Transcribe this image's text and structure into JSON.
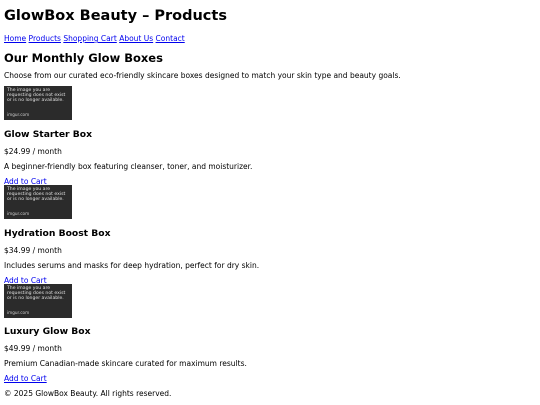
{
  "header": {
    "title": "GlowBox Beauty – Products"
  },
  "nav": {
    "items": [
      "Home",
      "Products",
      "Shopping Cart",
      "About Us",
      "Contact"
    ]
  },
  "main": {
    "heading": "Our Monthly Glow Boxes",
    "intro": "Choose from our curated eco-friendly skincare boxes designed to match your skin type and beauty goals.",
    "placeholder": {
      "line1": "The image you are",
      "line2": "requesting does not exist",
      "line3": "or is no longer available.",
      "brand": "imgur.com"
    },
    "products": [
      {
        "name": "Glow Starter Box",
        "price": "$24.99 / month",
        "description": "A beginner-friendly box featuring cleanser, toner, and moisturizer.",
        "cta": "Add to Cart"
      },
      {
        "name": "Hydration Boost Box",
        "price": "$34.99 / month",
        "description": "Includes serums and masks for deep hydration, perfect for dry skin.",
        "cta": "Add to Cart"
      },
      {
        "name": "Luxury Glow Box",
        "price": "$49.99 / month",
        "description": "Premium Canadian-made skincare curated for maximum results.",
        "cta": "Add to Cart"
      }
    ]
  },
  "footer": {
    "text": "© 2025 GlowBox Beauty. All rights reserved."
  },
  "colors": {
    "link": "#0000ee",
    "placeholder_bg": "#2b2b2b"
  }
}
